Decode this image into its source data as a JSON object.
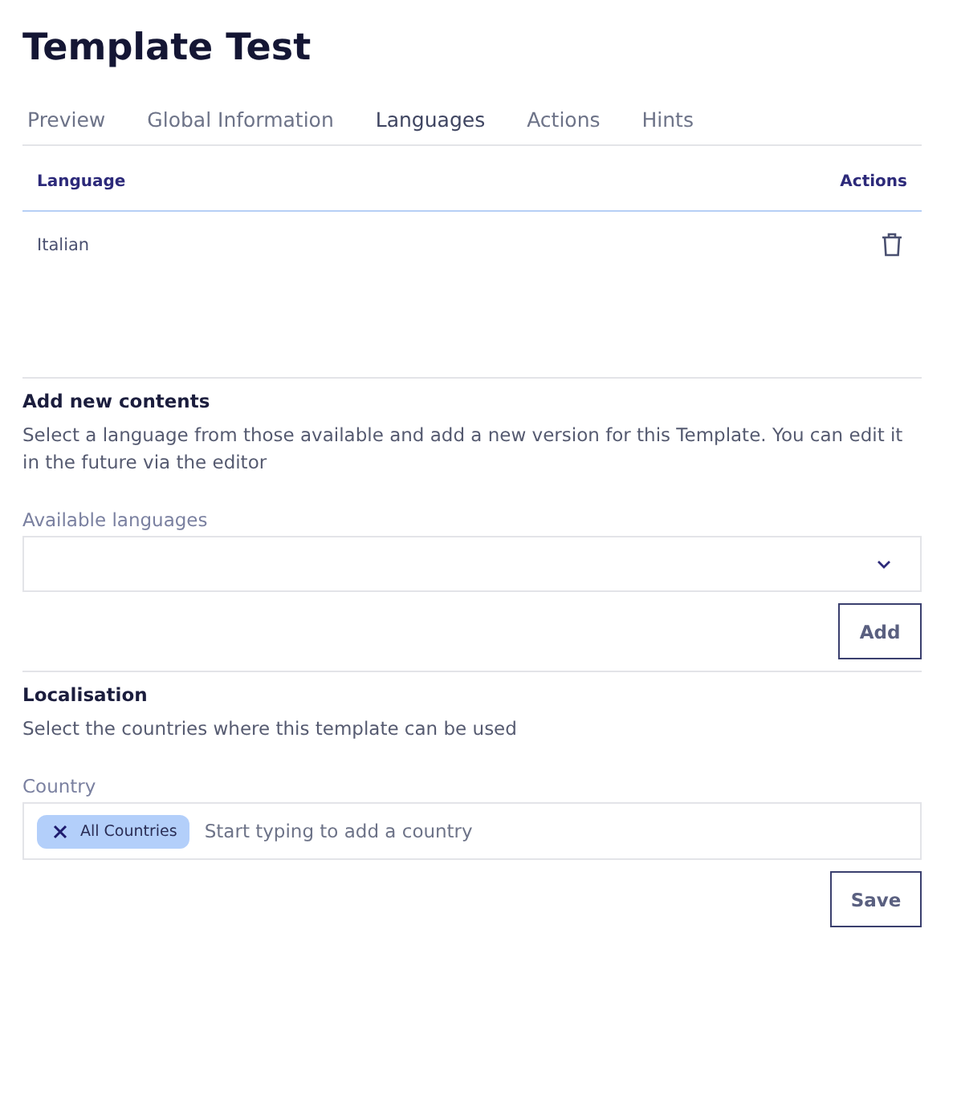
{
  "title": "Template Test",
  "tabs": [
    {
      "label": "Preview",
      "selected": false
    },
    {
      "label": "Global Information",
      "selected": false
    },
    {
      "label": "Languages",
      "selected": true
    },
    {
      "label": "Actions",
      "selected": false
    },
    {
      "label": "Hints",
      "selected": false
    }
  ],
  "table": {
    "columns": [
      "Language",
      "Actions"
    ],
    "rows": [
      {
        "language": "Italian"
      }
    ]
  },
  "add_section": {
    "heading": "Add new contents",
    "description": "Select a language from those available and add a new version for this Template. You can edit it in the future via the editor",
    "field_label": "Available languages",
    "button": "Add"
  },
  "localisation": {
    "heading": "Localisation",
    "description": "Select the countries where this template can be used",
    "field_label": "Country",
    "chips": [
      "All Countries"
    ],
    "placeholder": "Start typing to add a country",
    "button": "Save"
  }
}
